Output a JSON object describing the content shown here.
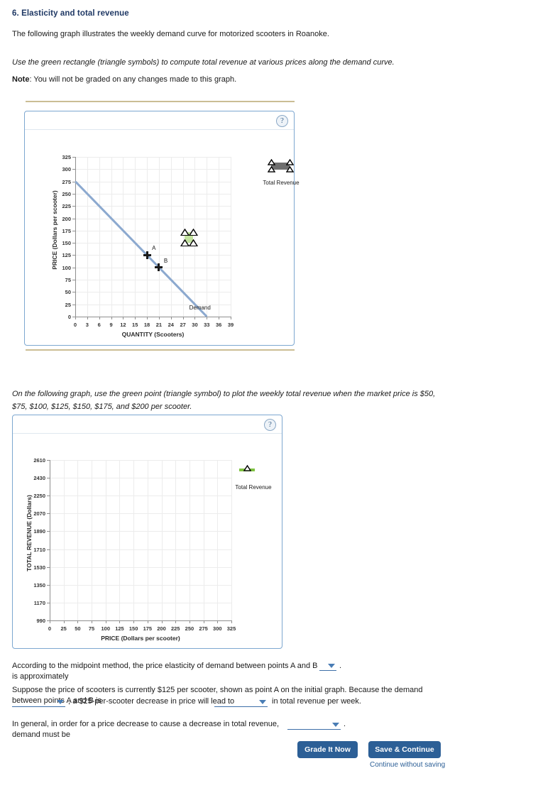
{
  "question": {
    "number_title": "6. Elasticity and total revenue",
    "intro": "The following graph illustrates the weekly demand curve for motorized scooters in Roanoke.",
    "instruction_italic": "Use the green rectangle (triangle symbols) to compute total revenue at various prices along the demand curve.",
    "note_label": "Note",
    "note_text": ": You will not be graded on any changes made to this graph.",
    "second_instruction": "On the following graph, use the green point (triangle symbol) to plot the weekly total revenue when the market price is $50, $75, $100, $125, $150, $175, and $200 per scooter."
  },
  "panel": {
    "help_glyph": "?"
  },
  "chart_data": [
    {
      "id": "demand-chart",
      "type": "line",
      "title": "",
      "xlabel": "QUANTITY (Scooters)",
      "ylabel": "PRICE (Dollars per scooter)",
      "xlim": [
        0,
        39
      ],
      "ylim": [
        0,
        325
      ],
      "xticks": [
        0,
        3,
        6,
        9,
        12,
        15,
        18,
        21,
        24,
        27,
        30,
        33,
        36,
        39
      ],
      "yticks": [
        0,
        25,
        50,
        75,
        100,
        125,
        150,
        175,
        200,
        225,
        250,
        275,
        300,
        325
      ],
      "grid": true,
      "series": [
        {
          "name": "Demand",
          "color": "#8ca9cf",
          "points": [
            [
              0,
              275
            ],
            [
              33,
              0
            ]
          ]
        }
      ],
      "annotations": [
        {
          "label": "Demand",
          "x": 28.6,
          "y": 18
        },
        {
          "label": "A",
          "x": 18,
          "y": 125,
          "marker": "cross"
        },
        {
          "label": "B",
          "x": 21,
          "y": 100,
          "marker": "cross"
        }
      ],
      "shape": {
        "name": "total-revenue-rectangle",
        "color": "#c3e3a0",
        "x0": 27.5,
        "x1": 29.6,
        "y0": 150,
        "y1": 172
      },
      "legend": {
        "position": "right",
        "entries": [
          {
            "label": "Total Revenue",
            "color": "#6e6e6e",
            "marker": "rect-with-triangles"
          }
        ]
      }
    },
    {
      "id": "total-revenue-chart",
      "type": "scatter",
      "title": "",
      "xlabel": "PRICE (Dollars per scooter)",
      "ylabel": "TOTAL REVENUE (Dollars)",
      "xlim": [
        0,
        325
      ],
      "ylim": [
        990,
        2610
      ],
      "xticks": [
        0,
        25,
        50,
        75,
        100,
        125,
        150,
        175,
        200,
        225,
        250,
        275,
        300,
        325
      ],
      "yticks": [
        990,
        1170,
        1350,
        1530,
        1710,
        1890,
        2070,
        2250,
        2430,
        2610
      ],
      "grid": true,
      "series": [
        {
          "name": "Total Revenue",
          "color": "#7fc241",
          "points": []
        }
      ],
      "legend": {
        "position": "right",
        "entries": [
          {
            "label": "Total Revenue",
            "color": "#7fc241",
            "marker": "green-bar-triangle"
          }
        ]
      }
    }
  ],
  "questions": [
    {
      "id": "q-elasticity",
      "text_before": "According to the midpoint method, the price elasticity of demand between points A and B is approximately",
      "selected": "",
      "text_after": "."
    },
    {
      "id": "q-revenue-change",
      "text_before": "Suppose the price of scooters is currently $125 per scooter, shown as point A on the initial graph. Because the demand between points A and B is",
      "selected_1": "",
      "text_middle": ", a $25-per-scooter decrease in price will lead to",
      "selected_2": "",
      "text_after": "in total revenue per week."
    },
    {
      "id": "q-general",
      "text_before": "In general, in order for a price decrease to cause a decrease in total revenue, demand must be",
      "selected": "",
      "text_after": "."
    }
  ],
  "footer": {
    "grade_button": "Grade It Now",
    "save_button": "Save & Continue",
    "continue_link": "Continue without saving"
  }
}
